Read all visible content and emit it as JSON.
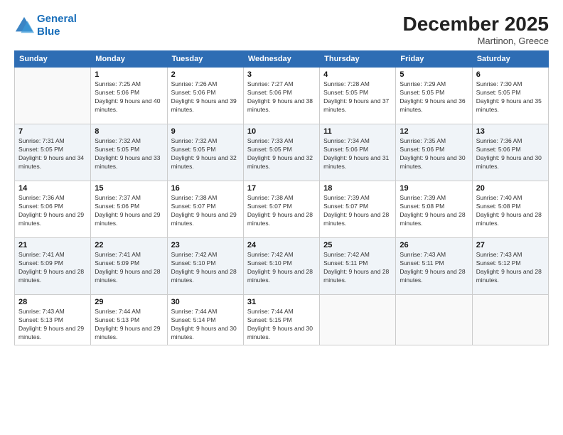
{
  "header": {
    "logo_line1": "General",
    "logo_line2": "Blue",
    "month": "December 2025",
    "location": "Martinon, Greece"
  },
  "weekdays": [
    "Sunday",
    "Monday",
    "Tuesday",
    "Wednesday",
    "Thursday",
    "Friday",
    "Saturday"
  ],
  "weeks": [
    [
      {
        "day": "",
        "empty": true
      },
      {
        "day": "1",
        "sunrise": "7:25 AM",
        "sunset": "5:06 PM",
        "daylight": "9 hours and 40 minutes."
      },
      {
        "day": "2",
        "sunrise": "7:26 AM",
        "sunset": "5:06 PM",
        "daylight": "9 hours and 39 minutes."
      },
      {
        "day": "3",
        "sunrise": "7:27 AM",
        "sunset": "5:06 PM",
        "daylight": "9 hours and 38 minutes."
      },
      {
        "day": "4",
        "sunrise": "7:28 AM",
        "sunset": "5:05 PM",
        "daylight": "9 hours and 37 minutes."
      },
      {
        "day": "5",
        "sunrise": "7:29 AM",
        "sunset": "5:05 PM",
        "daylight": "9 hours and 36 minutes."
      },
      {
        "day": "6",
        "sunrise": "7:30 AM",
        "sunset": "5:05 PM",
        "daylight": "9 hours and 35 minutes."
      }
    ],
    [
      {
        "day": "7",
        "sunrise": "7:31 AM",
        "sunset": "5:05 PM",
        "daylight": "9 hours and 34 minutes."
      },
      {
        "day": "8",
        "sunrise": "7:32 AM",
        "sunset": "5:05 PM",
        "daylight": "9 hours and 33 minutes."
      },
      {
        "day": "9",
        "sunrise": "7:32 AM",
        "sunset": "5:05 PM",
        "daylight": "9 hours and 32 minutes."
      },
      {
        "day": "10",
        "sunrise": "7:33 AM",
        "sunset": "5:05 PM",
        "daylight": "9 hours and 32 minutes."
      },
      {
        "day": "11",
        "sunrise": "7:34 AM",
        "sunset": "5:06 PM",
        "daylight": "9 hours and 31 minutes."
      },
      {
        "day": "12",
        "sunrise": "7:35 AM",
        "sunset": "5:06 PM",
        "daylight": "9 hours and 30 minutes."
      },
      {
        "day": "13",
        "sunrise": "7:36 AM",
        "sunset": "5:06 PM",
        "daylight": "9 hours and 30 minutes."
      }
    ],
    [
      {
        "day": "14",
        "sunrise": "7:36 AM",
        "sunset": "5:06 PM",
        "daylight": "9 hours and 29 minutes."
      },
      {
        "day": "15",
        "sunrise": "7:37 AM",
        "sunset": "5:06 PM",
        "daylight": "9 hours and 29 minutes."
      },
      {
        "day": "16",
        "sunrise": "7:38 AM",
        "sunset": "5:07 PM",
        "daylight": "9 hours and 29 minutes."
      },
      {
        "day": "17",
        "sunrise": "7:38 AM",
        "sunset": "5:07 PM",
        "daylight": "9 hours and 28 minutes."
      },
      {
        "day": "18",
        "sunrise": "7:39 AM",
        "sunset": "5:07 PM",
        "daylight": "9 hours and 28 minutes."
      },
      {
        "day": "19",
        "sunrise": "7:39 AM",
        "sunset": "5:08 PM",
        "daylight": "9 hours and 28 minutes."
      },
      {
        "day": "20",
        "sunrise": "7:40 AM",
        "sunset": "5:08 PM",
        "daylight": "9 hours and 28 minutes."
      }
    ],
    [
      {
        "day": "21",
        "sunrise": "7:41 AM",
        "sunset": "5:09 PM",
        "daylight": "9 hours and 28 minutes."
      },
      {
        "day": "22",
        "sunrise": "7:41 AM",
        "sunset": "5:09 PM",
        "daylight": "9 hours and 28 minutes."
      },
      {
        "day": "23",
        "sunrise": "7:42 AM",
        "sunset": "5:10 PM",
        "daylight": "9 hours and 28 minutes."
      },
      {
        "day": "24",
        "sunrise": "7:42 AM",
        "sunset": "5:10 PM",
        "daylight": "9 hours and 28 minutes."
      },
      {
        "day": "25",
        "sunrise": "7:42 AM",
        "sunset": "5:11 PM",
        "daylight": "9 hours and 28 minutes."
      },
      {
        "day": "26",
        "sunrise": "7:43 AM",
        "sunset": "5:11 PM",
        "daylight": "9 hours and 28 minutes."
      },
      {
        "day": "27",
        "sunrise": "7:43 AM",
        "sunset": "5:12 PM",
        "daylight": "9 hours and 28 minutes."
      }
    ],
    [
      {
        "day": "28",
        "sunrise": "7:43 AM",
        "sunset": "5:13 PM",
        "daylight": "9 hours and 29 minutes."
      },
      {
        "day": "29",
        "sunrise": "7:44 AM",
        "sunset": "5:13 PM",
        "daylight": "9 hours and 29 minutes."
      },
      {
        "day": "30",
        "sunrise": "7:44 AM",
        "sunset": "5:14 PM",
        "daylight": "9 hours and 30 minutes."
      },
      {
        "day": "31",
        "sunrise": "7:44 AM",
        "sunset": "5:15 PM",
        "daylight": "9 hours and 30 minutes."
      },
      {
        "day": "",
        "empty": true
      },
      {
        "day": "",
        "empty": true
      },
      {
        "day": "",
        "empty": true
      }
    ]
  ],
  "labels": {
    "sunrise": "Sunrise:",
    "sunset": "Sunset:",
    "daylight": "Daylight:"
  }
}
